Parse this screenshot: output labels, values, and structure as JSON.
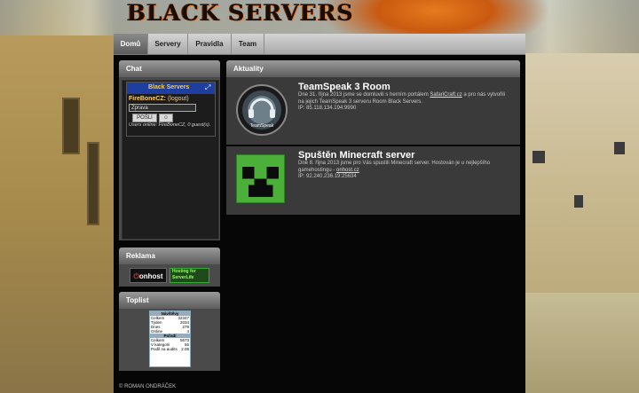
{
  "site": {
    "logo_text": "BLACK SERVERS"
  },
  "nav": {
    "items": [
      "Domů",
      "Servery",
      "Pravidla",
      "Team"
    ],
    "active": "Domů"
  },
  "chat": {
    "title": "Chat",
    "brand": "Black Servers",
    "expand_icon": "expand-icon",
    "username": "FireBoneCZ:",
    "logout": "(logout)",
    "input_value": "Zprava",
    "send_label": "POŠLI",
    "emoji_label": "☺",
    "users_online": "Users online: FireBoneCZ, 0 guest(s)."
  },
  "ads": {
    "title": "Reklama",
    "onhost_label": "onhost",
    "server_label": "Hosting for ServerLife"
  },
  "toplist": {
    "title": "Toplist",
    "head1": "Návštěvy",
    "rows1": [
      [
        "Celkem",
        "32347"
      ],
      [
        "Týden",
        "2034"
      ],
      [
        "Dnes",
        "279"
      ],
      [
        "Online",
        "4"
      ]
    ],
    "head2": "Pořadí",
    "rows2": [
      [
        "Celkem",
        "5673"
      ],
      [
        "V kategorii",
        "55"
      ],
      [
        "Podíl na audits",
        "2.08"
      ]
    ]
  },
  "news_panel": {
    "title": "Aktuality"
  },
  "news": [
    {
      "title": "TeamSpeak 3 Room",
      "text_before": "Dne 31. října 2013 jsme se domluvili s herním portálem ",
      "link": "SafariCraft.cz",
      "text_after": " a pro nás vytvořili na jejich TeamSpeak 3 serveru Room Black Servers.",
      "ip": "IP: 85.118.134.194:9990",
      "icon": "teamspeak-icon",
      "icon_label": "TeamSpeak"
    },
    {
      "title": "Spuštěn Minecraft server",
      "text_before": "Dne 8. října 2013 jsme pro Vás spustili Minecraft server. Hostován je u nejlepšího gamehostingu - ",
      "link": "onhost.cz",
      "text_after": "",
      "ip": "IP: 92.240.236.19:25634",
      "icon": "minecraft-creeper-icon"
    }
  ],
  "footer": {
    "text": "© ROMAN ONDRÁČEK"
  },
  "colors": {
    "nav_active": "#6e6e6e",
    "panel_bg": "#4a4a4a",
    "chat_bar": "#1f3fa0",
    "brand_yellow": "#ffcc33"
  }
}
